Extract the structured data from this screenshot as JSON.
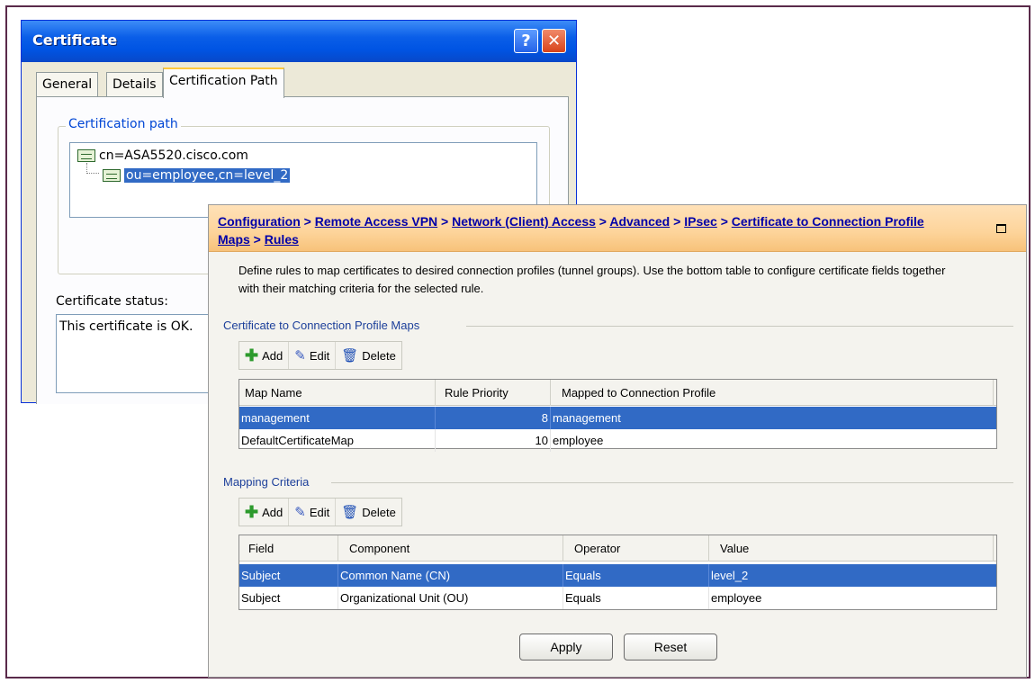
{
  "certificate_dialog": {
    "title": "Certificate",
    "help_glyph": "?",
    "close_glyph": "✕",
    "tabs": [
      "General",
      "Details",
      "Certification Path"
    ],
    "active_tab": "Certification Path",
    "path_group_label": "Certification path",
    "tree": [
      {
        "label": "cn=ASA5520.cisco.com",
        "icon": "certificate-icon"
      },
      {
        "label": "ou=employee,cn=level_2",
        "icon": "certificate-icon",
        "selected": true
      }
    ],
    "status_label": "Certificate status:",
    "status_text": "This certificate is OK."
  },
  "asdm": {
    "breadcrumb": [
      "Configuration",
      "Remote Access VPN",
      "Network (Client) Access",
      "Advanced",
      "IPsec",
      "Certificate to Connection Profile Maps",
      "Rules"
    ],
    "breadcrumb_sep": " > ",
    "description": "Define rules to map certificates to desired connection profiles (tunnel groups). Use the bottom table to configure certificate fields together with their matching criteria for the selected rule.",
    "maps_section": {
      "title": "Certificate to Connection Profile Maps",
      "toolbar": {
        "add": "Add",
        "edit": "Edit",
        "delete": "Delete"
      },
      "columns": [
        "Map Name",
        "Rule Priority",
        "Mapped to Connection Profile"
      ],
      "rows": [
        {
          "map_name": "management",
          "priority": "8",
          "profile": "management",
          "selected": true
        },
        {
          "map_name": "DefaultCertificateMap",
          "priority": "10",
          "profile": "employee",
          "selected": false
        }
      ]
    },
    "criteria_section": {
      "title": "Mapping Criteria",
      "toolbar": {
        "add": "Add",
        "edit": "Edit",
        "delete": "Delete"
      },
      "columns": [
        "Field",
        "Component",
        "Operator",
        "Value"
      ],
      "rows": [
        {
          "field": "Subject",
          "component": "Common Name (CN)",
          "operator": "Equals",
          "value": "level_2",
          "selected": true
        },
        {
          "field": "Subject",
          "component": "Organizational Unit (OU)",
          "operator": "Equals",
          "value": "employee",
          "selected": false
        }
      ]
    },
    "apply_label": "Apply",
    "reset_label": "Reset"
  }
}
